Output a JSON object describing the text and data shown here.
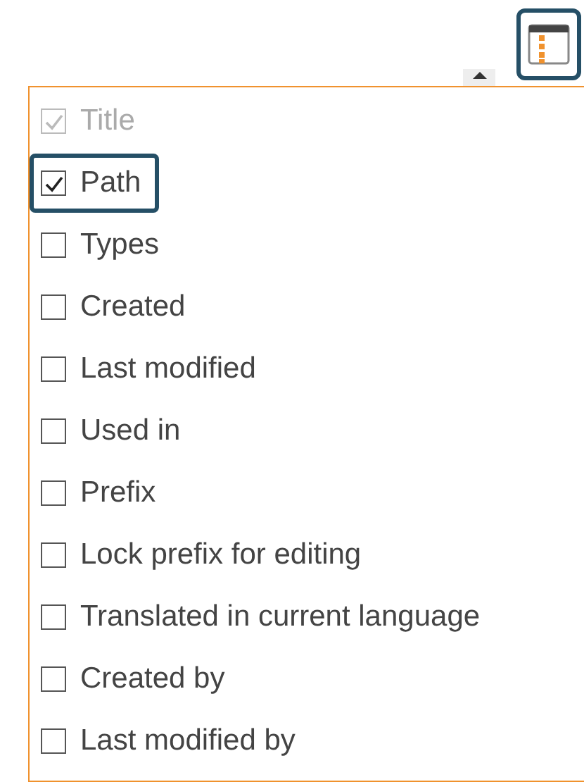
{
  "columns_button": {
    "highlighted": true
  },
  "column_options": [
    {
      "label": "Title",
      "checked": true,
      "disabled": true,
      "highlighted": false
    },
    {
      "label": "Path",
      "checked": true,
      "disabled": false,
      "highlighted": true
    },
    {
      "label": "Types",
      "checked": false,
      "disabled": false,
      "highlighted": false
    },
    {
      "label": "Created",
      "checked": false,
      "disabled": false,
      "highlighted": false
    },
    {
      "label": "Last modified",
      "checked": false,
      "disabled": false,
      "highlighted": false
    },
    {
      "label": "Used in",
      "checked": false,
      "disabled": false,
      "highlighted": false
    },
    {
      "label": "Prefix",
      "checked": false,
      "disabled": false,
      "highlighted": false
    },
    {
      "label": "Lock prefix for editing",
      "checked": false,
      "disabled": false,
      "highlighted": false
    },
    {
      "label": "Translated in current language",
      "checked": false,
      "disabled": false,
      "highlighted": false
    },
    {
      "label": "Created by",
      "checked": false,
      "disabled": false,
      "highlighted": false
    },
    {
      "label": "Last modified by",
      "checked": false,
      "disabled": false,
      "highlighted": false
    }
  ]
}
